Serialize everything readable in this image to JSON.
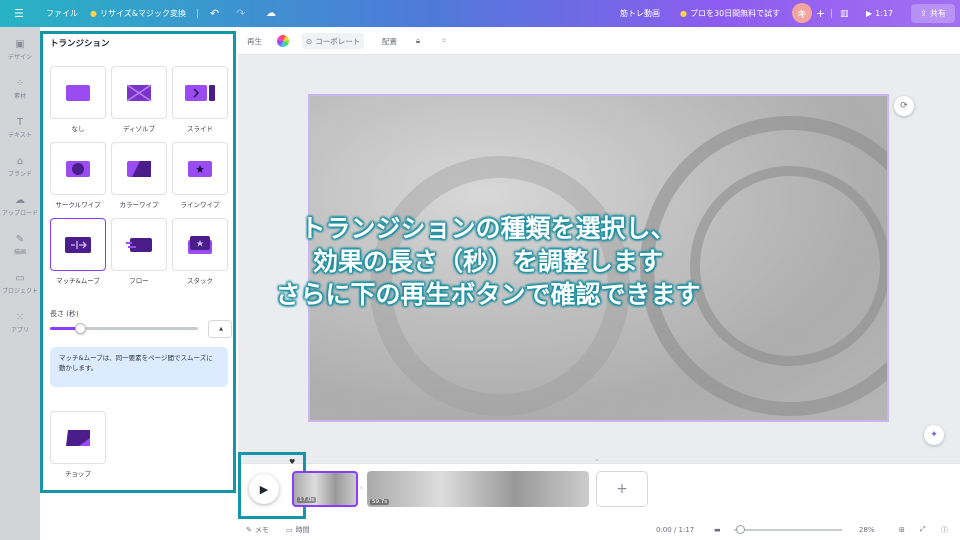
{
  "topbar": {
    "menu_icon": "hamburger-icon",
    "file_label": "ファイル",
    "magic_resize_label": "リサイズ&マジック変換",
    "undo_icon": "undo-icon",
    "redo_icon": "redo-icon",
    "cloud_icon": "cloud-icon",
    "doc_title": "筋トレ動画",
    "trial_label": "プロを30日間無料で試す",
    "avatar_initial": "キ",
    "add_icon": "plus-icon",
    "stats_icon": "bar-chart-icon",
    "play_time": "1:17",
    "share_label": "共有"
  },
  "rail": {
    "items": [
      {
        "icon": "design-icon",
        "label": "デザイン"
      },
      {
        "icon": "elements-icon",
        "label": "素材"
      },
      {
        "icon": "text-icon",
        "label": "テキスト"
      },
      {
        "icon": "brand-icon",
        "label": "ブランド"
      },
      {
        "icon": "upload-icon",
        "label": "アップロード"
      },
      {
        "icon": "draw-icon",
        "label": "描画"
      },
      {
        "icon": "folder-icon",
        "label": "プロジェクト"
      },
      {
        "icon": "apps-icon",
        "label": "アプリ"
      }
    ]
  },
  "panel": {
    "title": "トランジション",
    "transitions": [
      {
        "label": "なし"
      },
      {
        "label": "ディゾルブ"
      },
      {
        "label": "スライド"
      },
      {
        "label": "サークルワイプ"
      },
      {
        "label": "カラーワイプ"
      },
      {
        "label": "ラインワイプ"
      },
      {
        "label": "マッチ&ムーブ",
        "selected": true
      },
      {
        "label": "フロー"
      },
      {
        "label": "スタック"
      },
      {
        "label": "チョップ"
      }
    ],
    "length_label": "長さ (秒)",
    "length_value": "",
    "length_fraction": 0.2,
    "info_text": "マッチ&ムーブは、同一要素をページ間でスムーズに動かします。"
  },
  "toolbar": {
    "play_label": "再生",
    "collaborate_label": "コーポレート",
    "position_label": "配置"
  },
  "caption": {
    "line1": "トランジションの種類を選択し、",
    "line2": "効果の長さ（秒）を調整します",
    "line3": "さらに下の再生ボタンで確認できます"
  },
  "timeline": {
    "clip1_duration": "17.0s",
    "clip2_duration": "59.7s",
    "add_label": "+"
  },
  "bottombar": {
    "memo_label": "メモ",
    "time_label": "時間",
    "time_readout": "0:00 / 1:17",
    "zoom": "28%"
  },
  "colors": {
    "accent": "#8b3dff",
    "highlight": "#1496a8",
    "transition_fill": "#9a4cf2"
  }
}
